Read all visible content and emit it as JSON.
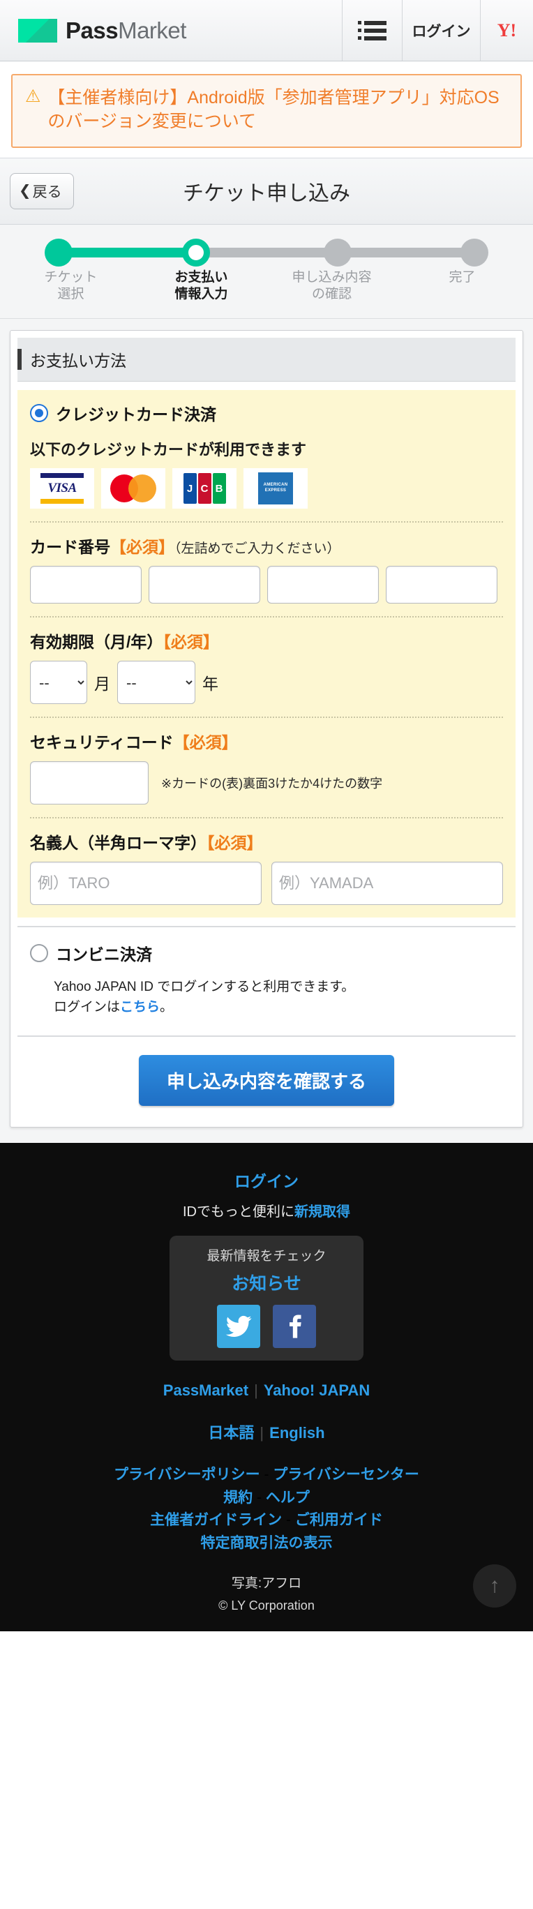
{
  "header": {
    "brand_bold": "Pass",
    "brand_light": "Market",
    "menu_icon": "list-menu-icon",
    "login_label": "ログイン",
    "yahoo_label": "Y!"
  },
  "alert": {
    "icon": "warning-triangle-icon",
    "text": "【主催者様向け】Android版「参加者管理アプリ」対応OSのバージョン変更について",
    "border_color": "#f6a96a",
    "text_color": "#f07d2a"
  },
  "titlebar": {
    "back_label": "戻る",
    "back_chevron": "❮",
    "title": "チケット申し込み"
  },
  "stepper": {
    "accent_color": "#00c89b",
    "inactive_color": "#b9bcbf",
    "steps": [
      {
        "label_line1": "チケット",
        "label_line2": "選択",
        "state": "done"
      },
      {
        "label_line1": "お支払い",
        "label_line2": "情報入力",
        "state": "current"
      },
      {
        "label_line1": "申し込み内容",
        "label_line2": "の確認",
        "state": "todo"
      },
      {
        "label_line1": "完了",
        "label_line2": "",
        "state": "todo"
      }
    ]
  },
  "payment": {
    "section_title": "お支払い方法",
    "credit": {
      "radio_label": "クレジットカード決済",
      "selected": true,
      "accepted_note": "以下のクレジットカードが利用できます",
      "card_brands": [
        "VISA",
        "Mastercard",
        "JCB",
        "AMERICAN EXPRESS"
      ]
    },
    "card_number": {
      "label": "カード番号",
      "required": "【必須】",
      "hint": "（左詰めでご入力ください）",
      "values": [
        "",
        "",
        "",
        ""
      ]
    },
    "expiry": {
      "label": "有効期限（月/年）",
      "required": "【必須】",
      "month_value": "--",
      "month_unit": "月",
      "year_value": "--",
      "year_unit": "年"
    },
    "security_code": {
      "label": "セキュリティコード",
      "required": "【必須】",
      "value": "",
      "note": "※カードの(表)裏面3けたか4けたの数字"
    },
    "holder": {
      "label": "名義人（半角ローマ字）",
      "required": "【必須】",
      "first_placeholder": "例）TARO",
      "last_placeholder": "例）YAMADA",
      "first_value": "",
      "last_value": ""
    },
    "conveni": {
      "radio_label": "コンビニ決済",
      "selected": false,
      "note_line1": "Yahoo JAPAN ID でログインすると利用できます。",
      "note_line2_pre": "ログインは",
      "note_link": "こちら",
      "note_line2_post": "。"
    },
    "submit_label": "申し込み内容を確認する",
    "submit_color": "#2e8de0"
  },
  "footer": {
    "login_link": "ログイン",
    "id_text": "IDでもっと便利に",
    "id_link": "新規取得",
    "news_title": "最新情報をチェック",
    "news_link": "お知らせ",
    "social": [
      "twitter-icon",
      "facebook-icon"
    ],
    "brand_row": {
      "left": "PassMarket",
      "right": "Yahoo! JAPAN",
      "sep": "|"
    },
    "lang_row": {
      "left": "日本語",
      "right": "English",
      "sep": "|"
    },
    "links_line1": [
      "プライバシーポリシー",
      "プライバシーセンター"
    ],
    "links_line2": [
      "規約",
      "ヘルプ"
    ],
    "links_line3": [
      "主催者ガイドライン",
      "ご利用ガイド"
    ],
    "links_line4": [
      "特定商取引法の表示"
    ],
    "link_sep": "-",
    "credit": "写真:アフロ",
    "copyright": "© LY Corporation",
    "to_top_icon": "arrow-up-icon"
  }
}
